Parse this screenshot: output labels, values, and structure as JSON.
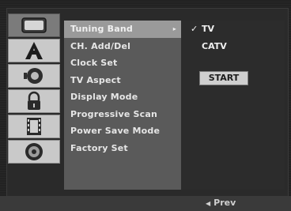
{
  "menu": {
    "items": [
      {
        "label": "Tuning Band"
      },
      {
        "label": "CH. Add/Del"
      },
      {
        "label": "Clock Set"
      },
      {
        "label": "TV Aspect"
      },
      {
        "label": "Display Mode"
      },
      {
        "label": "Progressive Scan"
      },
      {
        "label": "Power Save Mode"
      },
      {
        "label": "Factory Set"
      }
    ],
    "selected_index": 0,
    "submenu_arrow": "▸"
  },
  "options": {
    "tv": {
      "label": "TV",
      "check": "✓"
    },
    "catv": {
      "label": "CATV"
    },
    "start_label": "START"
  },
  "icons": [
    "tv-screen-icon",
    "language-a-icon",
    "speaker-audio-icon",
    "padlock-icon",
    "film-strip-icon",
    "disc-icon"
  ],
  "footer": {
    "prev_label": "Prev",
    "prev_arrow": "◀"
  },
  "colors": {
    "menu_bg": "#5a5a5a",
    "selected_bg": "#9a9a9a",
    "icon_bg": "#c9c9c9",
    "icon_active_bg": "#7b7b7b"
  }
}
